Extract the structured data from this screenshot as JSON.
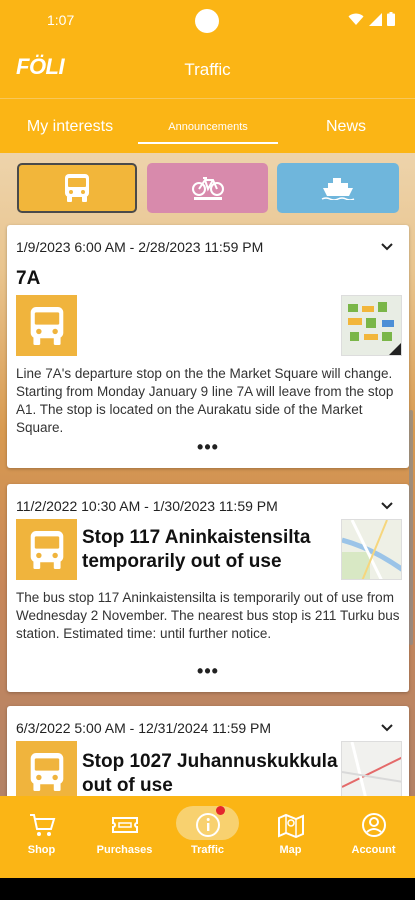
{
  "status_bar": {
    "time": "1:07"
  },
  "header": {
    "logo": "FÖLI",
    "title": "Traffic"
  },
  "tabs": [
    {
      "label": "My interests"
    },
    {
      "label": "Announcements"
    },
    {
      "label": "News"
    }
  ],
  "mode_filters": [
    {
      "name": "bus",
      "icon": "bus-icon",
      "color": "#f2b63a",
      "selected": true
    },
    {
      "name": "bike",
      "icon": "bike-icon",
      "color": "#d88aac",
      "selected": false
    },
    {
      "name": "boat",
      "icon": "boat-icon",
      "color": "#6fb6dc",
      "selected": false
    }
  ],
  "announcements": [
    {
      "date": "1/9/2023 6:00 AM - 2/28/2023 11:59 PM",
      "title": "7A",
      "body": "Line 7A's departure stop on the the Market Square will change. Starting from Monday January 9 line 7A will leave from the stop A1. The stop is located on the Aurakatu side of the Market Square.",
      "more": "•••"
    },
    {
      "date": "11/2/2022 10:30 AM - 1/30/2023 11:59 PM",
      "title": "Stop 117 Aninkaistensilta temporarily out of  use",
      "body": "The bus stop 117 Aninkaistensilta is temporarily out of use from Wednesday 2 November. The nearest  bus stop is 211 Turku bus station. Estimated time: until further notice.",
      "more": "•••"
    },
    {
      "date": "6/3/2022 5:00 AM - 12/31/2024 11:59 PM",
      "title": "Stop 1027 Juhannuskukkula out of use"
    }
  ],
  "bottom_nav": [
    {
      "label": "Shop",
      "icon": "cart-icon"
    },
    {
      "label": "Purchases",
      "icon": "ticket-icon"
    },
    {
      "label": "Traffic",
      "icon": "info-icon",
      "active": true
    },
    {
      "label": "Map",
      "icon": "map-icon"
    },
    {
      "label": "Account",
      "icon": "account-icon"
    }
  ],
  "colors": {
    "brand": "#fbb515",
    "notification": "#e4262d"
  }
}
